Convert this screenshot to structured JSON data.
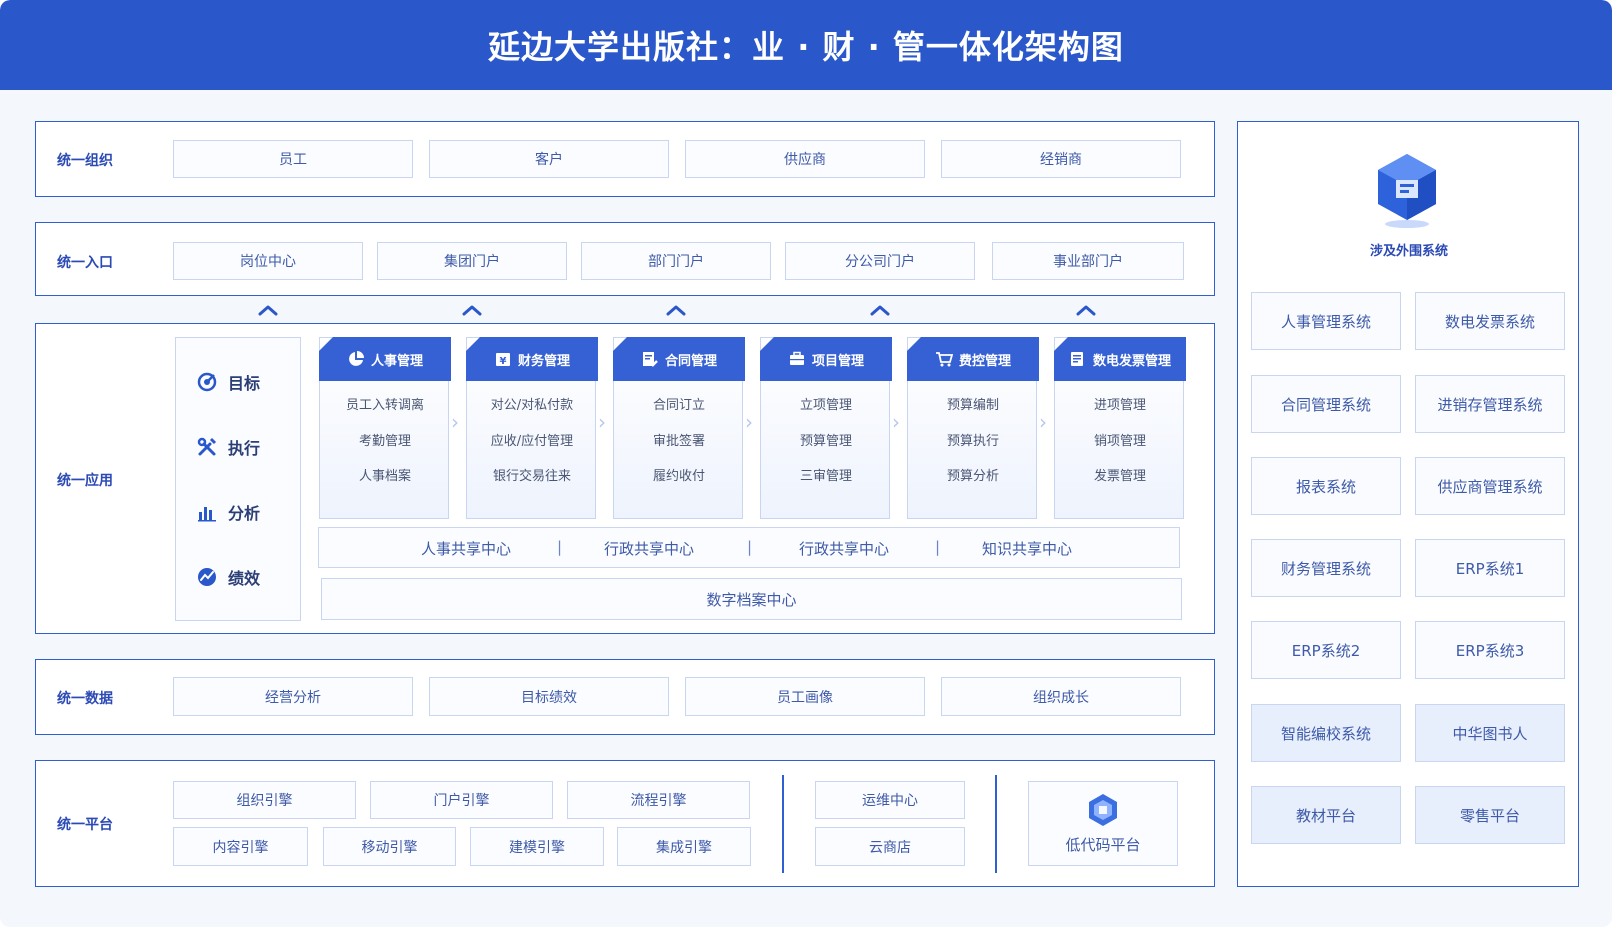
{
  "title": "延边大学出版社：业 · 财 · 管一体化架构图",
  "colors": {
    "primary": "#2a57c9",
    "border": "#2f5fd0",
    "cell_border": "#c9d6f2",
    "text": "#3e5aa8"
  },
  "org": {
    "label": "统一组织",
    "items": [
      "员工",
      "客户",
      "供应商",
      "经销商"
    ]
  },
  "entry": {
    "label": "统一入口",
    "items": [
      "岗位中心",
      "集团门户",
      "部门门户",
      "分公司门户",
      "事业部门户"
    ]
  },
  "app": {
    "label": "统一应用",
    "side": [
      {
        "label": "目标",
        "icon": "target-icon"
      },
      {
        "label": "执行",
        "icon": "tools-icon"
      },
      {
        "label": "分析",
        "icon": "bar-chart-icon"
      },
      {
        "label": "绩效",
        "icon": "trend-icon"
      }
    ],
    "modules": [
      {
        "title": "人事管理",
        "icon": "pie-chart-icon",
        "items": [
          "员工入转调离",
          "考勤管理",
          "人事档案"
        ]
      },
      {
        "title": "财务管理",
        "icon": "yen-icon",
        "items": [
          "对公/对私付款",
          "应收/应付管理",
          "银行交易往来"
        ]
      },
      {
        "title": "合同管理",
        "icon": "contract-icon",
        "items": [
          "合同订立",
          "审批签署",
          "履约收付"
        ]
      },
      {
        "title": "项目管理",
        "icon": "briefcase-icon",
        "items": [
          "立项管理",
          "预算管理",
          "三审管理"
        ]
      },
      {
        "title": "费控管理",
        "icon": "cart-icon",
        "items": [
          "预算编制",
          "预算执行",
          "预算分析"
        ]
      },
      {
        "title": "数电发票管理",
        "icon": "invoice-icon",
        "items": [
          "进项管理",
          "销项管理",
          "发票管理"
        ]
      }
    ],
    "shared": [
      "人事共享中心",
      "行政共享中心",
      "行政共享中心",
      "知识共享中心"
    ],
    "shared_sep": "|",
    "archive": "数字档案中心"
  },
  "data": {
    "label": "统一数据",
    "items": [
      "经营分析",
      "目标绩效",
      "员工画像",
      "组织成长"
    ]
  },
  "platform": {
    "label": "统一平台",
    "engines_top": [
      "组织引擎",
      "门户引擎",
      "流程引擎"
    ],
    "engines_bottom": [
      "内容引擎",
      "移动引擎",
      "建模引擎",
      "集成引擎"
    ],
    "ops": [
      "运维中心",
      "云商店"
    ],
    "lowcode": "低代码平台"
  },
  "external": {
    "label": "涉及外围系统",
    "systems": [
      "人事管理系统",
      "数电发票系统",
      "合同管理系统",
      "进销存管理系统",
      "报表系统",
      "供应商管理系统",
      "财务管理系统",
      "ERP系统1",
      "ERP系统2",
      "ERP系统3",
      "智能编校系统",
      "中华图书人",
      "教材平台",
      "零售平台"
    ]
  }
}
